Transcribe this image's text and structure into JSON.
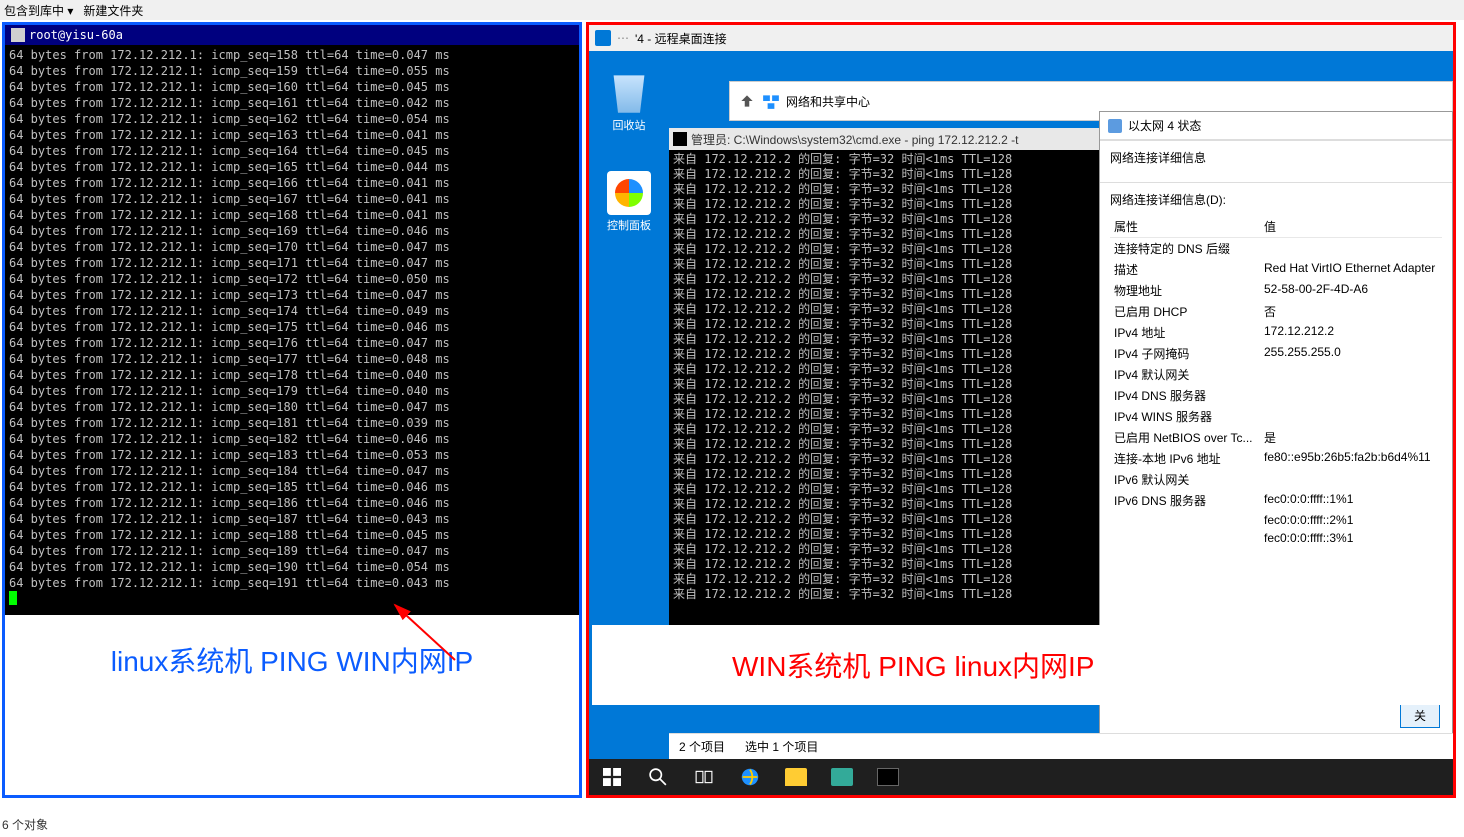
{
  "topbar": {
    "item1": "包含到库中 ▾",
    "item2": "新建文件夹"
  },
  "left": {
    "putty_title_prefix": "root@yisu-60a",
    "caption": "linux系统机 PING WIN内网IP",
    "ping_target": "172.12.212.1",
    "lines": [
      {
        "seq": 158,
        "time": "0.047"
      },
      {
        "seq": 159,
        "time": "0.055"
      },
      {
        "seq": 160,
        "time": "0.045"
      },
      {
        "seq": 161,
        "time": "0.042"
      },
      {
        "seq": 162,
        "time": "0.054"
      },
      {
        "seq": 163,
        "time": "0.041"
      },
      {
        "seq": 164,
        "time": "0.045"
      },
      {
        "seq": 165,
        "time": "0.044"
      },
      {
        "seq": 166,
        "time": "0.041"
      },
      {
        "seq": 167,
        "time": "0.041"
      },
      {
        "seq": 168,
        "time": "0.041"
      },
      {
        "seq": 169,
        "time": "0.046"
      },
      {
        "seq": 170,
        "time": "0.047"
      },
      {
        "seq": 171,
        "time": "0.047"
      },
      {
        "seq": 172,
        "time": "0.050"
      },
      {
        "seq": 173,
        "time": "0.047"
      },
      {
        "seq": 174,
        "time": "0.049"
      },
      {
        "seq": 175,
        "time": "0.046"
      },
      {
        "seq": 176,
        "time": "0.047"
      },
      {
        "seq": 177,
        "time": "0.048"
      },
      {
        "seq": 178,
        "time": "0.040"
      },
      {
        "seq": 179,
        "time": "0.040"
      },
      {
        "seq": 180,
        "time": "0.047"
      },
      {
        "seq": 181,
        "time": "0.039"
      },
      {
        "seq": 182,
        "time": "0.046"
      },
      {
        "seq": 183,
        "time": "0.053"
      },
      {
        "seq": 184,
        "time": "0.047"
      },
      {
        "seq": 185,
        "time": "0.046"
      },
      {
        "seq": 186,
        "time": "0.046"
      },
      {
        "seq": 187,
        "time": "0.043"
      },
      {
        "seq": 188,
        "time": "0.045"
      },
      {
        "seq": 189,
        "time": "0.047"
      },
      {
        "seq": 190,
        "time": "0.054"
      },
      {
        "seq": 191,
        "time": "0.043"
      }
    ]
  },
  "right": {
    "rdp_title_suffix": "'4 - 远程桌面连接",
    "recycle_label": "回收站",
    "cpanel_label": "控制面板",
    "explorer_icon_label": "网络和共享中心",
    "cmd_title": "管理员: C:\\Windows\\system32\\cmd.exe - ping  172.12.212.2 -t",
    "cmd_reply_target": "172.12.212.2",
    "cmd_reply_count": 30,
    "netstatus": {
      "title": "以太网 4 状态",
      "section_label": "网络连接详细信息",
      "detail_prompt": "网络连接详细信息(D):",
      "col_prop": "属性",
      "col_val": "值",
      "close_btn": "关",
      "rows": [
        {
          "p": "连接特定的 DNS 后缀",
          "v": ""
        },
        {
          "p": "描述",
          "v": "Red Hat VirtIO Ethernet Adapter"
        },
        {
          "p": "物理地址",
          "v": "52-58-00-2F-4D-A6"
        },
        {
          "p": "已启用 DHCP",
          "v": "否"
        },
        {
          "p": "IPv4 地址",
          "v": "172.12.212.2"
        },
        {
          "p": "IPv4 子网掩码",
          "v": "255.255.255.0"
        },
        {
          "p": "IPv4 默认网关",
          "v": ""
        },
        {
          "p": "IPv4 DNS 服务器",
          "v": ""
        },
        {
          "p": "IPv4 WINS 服务器",
          "v": ""
        },
        {
          "p": "已启用 NetBIOS over Tc...",
          "v": "是"
        },
        {
          "p": "连接-本地 IPv6 地址",
          "v": "fe80::e95b:26b5:fa2b:b6d4%11"
        },
        {
          "p": "IPv6 默认网关",
          "v": ""
        },
        {
          "p": "IPv6 DNS 服务器",
          "v": "fec0:0:0:ffff::1%1"
        },
        {
          "p": "",
          "v": "fec0:0:0:ffff::2%1"
        },
        {
          "p": "",
          "v": "fec0:0:0:ffff::3%1"
        }
      ]
    },
    "caption": "WIN系统机 PING linux内网IP",
    "explorer_status_items": "2 个项目",
    "explorer_status_sel": "选中 1 个项目"
  },
  "outer_status": "6 个对象"
}
